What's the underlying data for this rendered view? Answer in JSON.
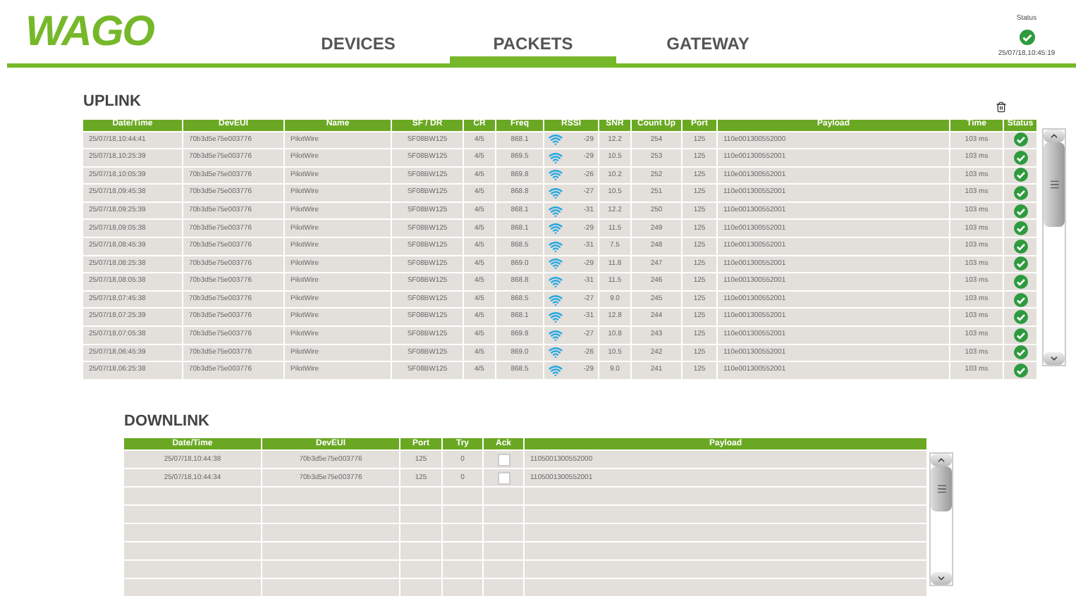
{
  "logo": "WAGO",
  "nav": [
    {
      "label": "DEVICES",
      "selected": false
    },
    {
      "label": "PACKETS",
      "selected": true
    },
    {
      "label": "GATEWAY",
      "selected": false
    }
  ],
  "status": {
    "label": "Status",
    "ok": true,
    "time": "25/07/18,10:45:19"
  },
  "uplink": {
    "title": "UPLINK",
    "columns": [
      "Date/Time",
      "DevEUI",
      "Name",
      "SF / DR",
      "CR",
      "Freq",
      "RSSI",
      "SNR",
      "Count Up",
      "Port",
      "Payload",
      "Time",
      "Status"
    ],
    "rows": [
      {
        "datetime": "25/07/18,10:44:41",
        "deveui": "70b3d5e75e003776",
        "name": "PilotWire",
        "sfdr": "SF08BW125",
        "cr": "4/5",
        "freq": "868.1",
        "rssi": "-29",
        "snr": "12.2",
        "count": "254",
        "port": "125",
        "payload": "110e001300552000",
        "time": "103 ms",
        "ok": true
      },
      {
        "datetime": "25/07/18,10:25:39",
        "deveui": "70b3d5e75e003776",
        "name": "PilotWire",
        "sfdr": "SF08BW125",
        "cr": "4/5",
        "freq": "869.5",
        "rssi": "-29",
        "snr": "10.5",
        "count": "253",
        "port": "125",
        "payload": "110e001300552001",
        "time": "103 ms",
        "ok": true
      },
      {
        "datetime": "25/07/18,10:05:39",
        "deveui": "70b3d5e75e003776",
        "name": "PilotWire",
        "sfdr": "SF08BW125",
        "cr": "4/5",
        "freq": "869.8",
        "rssi": "-26",
        "snr": "10.2",
        "count": "252",
        "port": "125",
        "payload": "110e001300552001",
        "time": "103 ms",
        "ok": true
      },
      {
        "datetime": "25/07/18,09:45:38",
        "deveui": "70b3d5e75e003776",
        "name": "PilotWire",
        "sfdr": "SF08BW125",
        "cr": "4/5",
        "freq": "868.8",
        "rssi": "-27",
        "snr": "10.5",
        "count": "251",
        "port": "125",
        "payload": "110e001300552001",
        "time": "103 ms",
        "ok": true
      },
      {
        "datetime": "25/07/18,09:25:39",
        "deveui": "70b3d5e75e003776",
        "name": "PilotWire",
        "sfdr": "SF08BW125",
        "cr": "4/5",
        "freq": "868.1",
        "rssi": "-31",
        "snr": "12.2",
        "count": "250",
        "port": "125",
        "payload": "110e001300552001",
        "time": "103 ms",
        "ok": true
      },
      {
        "datetime": "25/07/18,09:05:38",
        "deveui": "70b3d5e75e003776",
        "name": "PilotWire",
        "sfdr": "SF08BW125",
        "cr": "4/5",
        "freq": "868.1",
        "rssi": "-29",
        "snr": "11.5",
        "count": "249",
        "port": "125",
        "payload": "110e001300552001",
        "time": "103 ms",
        "ok": true
      },
      {
        "datetime": "25/07/18,08:45:39",
        "deveui": "70b3d5e75e003776",
        "name": "PilotWire",
        "sfdr": "SF08BW125",
        "cr": "4/5",
        "freq": "868.5",
        "rssi": "-31",
        "snr": "7.5",
        "count": "248",
        "port": "125",
        "payload": "110e001300552001",
        "time": "103 ms",
        "ok": true
      },
      {
        "datetime": "25/07/18,08:25:38",
        "deveui": "70b3d5e75e003776",
        "name": "PilotWire",
        "sfdr": "SF08BW125",
        "cr": "4/5",
        "freq": "869.0",
        "rssi": "-29",
        "snr": "11.8",
        "count": "247",
        "port": "125",
        "payload": "110e001300552001",
        "time": "103 ms",
        "ok": true
      },
      {
        "datetime": "25/07/18,08:05:38",
        "deveui": "70b3d5e75e003776",
        "name": "PilotWire",
        "sfdr": "SF08BW125",
        "cr": "4/5",
        "freq": "868.8",
        "rssi": "-31",
        "snr": "11.5",
        "count": "246",
        "port": "125",
        "payload": "110e001300552001",
        "time": "103 ms",
        "ok": true
      },
      {
        "datetime": "25/07/18,07:45:38",
        "deveui": "70b3d5e75e003776",
        "name": "PilotWire",
        "sfdr": "SF08BW125",
        "cr": "4/5",
        "freq": "868.5",
        "rssi": "-27",
        "snr": "9.0",
        "count": "245",
        "port": "125",
        "payload": "110e001300552001",
        "time": "103 ms",
        "ok": true
      },
      {
        "datetime": "25/07/18,07:25:39",
        "deveui": "70b3d5e75e003776",
        "name": "PilotWire",
        "sfdr": "SF08BW125",
        "cr": "4/5",
        "freq": "868.1",
        "rssi": "-31",
        "snr": "12.8",
        "count": "244",
        "port": "125",
        "payload": "110e001300552001",
        "time": "103 ms",
        "ok": true
      },
      {
        "datetime": "25/07/18,07:05:38",
        "deveui": "70b3d5e75e003776",
        "name": "PilotWire",
        "sfdr": "SF08BW125",
        "cr": "4/5",
        "freq": "869.8",
        "rssi": "-27",
        "snr": "10.8",
        "count": "243",
        "port": "125",
        "payload": "110e001300552001",
        "time": "103 ms",
        "ok": true
      },
      {
        "datetime": "25/07/18,06:45:39",
        "deveui": "70b3d5e75e003776",
        "name": "PilotWire",
        "sfdr": "SF08BW125",
        "cr": "4/5",
        "freq": "869.0",
        "rssi": "-26",
        "snr": "10.5",
        "count": "242",
        "port": "125",
        "payload": "110e001300552001",
        "time": "103 ms",
        "ok": true
      },
      {
        "datetime": "25/07/18,06:25:38",
        "deveui": "70b3d5e75e003776",
        "name": "PilotWire",
        "sfdr": "SF08BW125",
        "cr": "4/5",
        "freq": "868.5",
        "rssi": "-29",
        "snr": "9.0",
        "count": "241",
        "port": "125",
        "payload": "110e001300552001",
        "time": "103 ms",
        "ok": true
      }
    ]
  },
  "downlink": {
    "title": "DOWNLINK",
    "columns": [
      "Date/Time",
      "DevEUI",
      "Port",
      "Try",
      "Ack",
      "Payload"
    ],
    "rows": [
      {
        "datetime": "25/07/18,10:44:38",
        "deveui": "70b3d5e75e003776",
        "port": "125",
        "try": "0",
        "ack": false,
        "payload": "1105001300552000"
      },
      {
        "datetime": "25/07/18,10:44:34",
        "deveui": "70b3d5e75e003776",
        "port": "125",
        "try": "0",
        "ack": false,
        "payload": "1105001300552001"
      }
    ]
  }
}
